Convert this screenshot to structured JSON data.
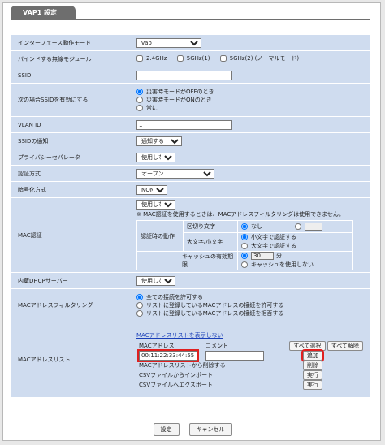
{
  "title": "VAP1 設定",
  "rows": {
    "interface": {
      "label": "インターフェース動作モード",
      "value": "vap"
    },
    "module": {
      "label": "バインドする無線モジュール",
      "options": [
        "2.4GHz",
        "5GHz(1)",
        "5GHz(2) (ノーマルモード)"
      ]
    },
    "ssid": {
      "label": "SSID",
      "value": ""
    },
    "ssid_enable": {
      "label": "次の場合SSIDを有効にする",
      "options": [
        "災害時モードがOFFのとき",
        "災害時モードがONのとき",
        "常に"
      ]
    },
    "vlan": {
      "label": "VLAN ID",
      "value": "1"
    },
    "ssid_notify": {
      "label": "SSIDの通知",
      "value": "通知する"
    },
    "privacy": {
      "label": "プライバシーセパレータ",
      "value": "使用しない"
    },
    "auth": {
      "label": "認証方式",
      "value": "オープン"
    },
    "encrypt": {
      "label": "暗号化方式",
      "value": "NONE"
    },
    "mac_auth": {
      "label": "MAC認証",
      "value": "使用しない",
      "note": "※ MAC認証を使用するときは、MACアドレスフィルタリングは使用できません。",
      "action_label": "認証時の動作",
      "delimiter_label": "区切り文字",
      "delimiter_options": [
        "なし"
      ],
      "case_label": "大文字/小文字",
      "case_options": [
        "小文字で認証する",
        "大文字で認証する"
      ],
      "cache_label": "キャッシュの有効期限",
      "cache_value": "30",
      "cache_unit": "分",
      "cache_no": "キャッシュを使用しない"
    },
    "dhcp": {
      "label": "内蔵DHCPサーバー",
      "value": "使用しない"
    },
    "mac_filter": {
      "label": "MACアドレスフィルタリング",
      "options": [
        "全ての接続を許可する",
        "リストに登録しているMACアドレスの接続を許可する",
        "リストに登録しているMACアドレスの接続を拒否する"
      ]
    },
    "mac_list": {
      "label": "MACアドレスリスト",
      "link": "MACアドレスリストを表示しない",
      "col_mac": "MACアドレス",
      "col_comment": "コメント",
      "select_all": "すべて選択",
      "deselect_all": "すべて解除",
      "mac_value": "00:11:22:33:44:55",
      "add": "追加",
      "delete_label": "MACアドレスリストから削除する",
      "delete": "削除",
      "import_label": "CSVファイルからインポート",
      "import": "実行",
      "export_label": "CSVファイルへエクスポート",
      "export": "実行"
    }
  },
  "footer": {
    "save": "設定",
    "cancel": "キャンセル"
  }
}
